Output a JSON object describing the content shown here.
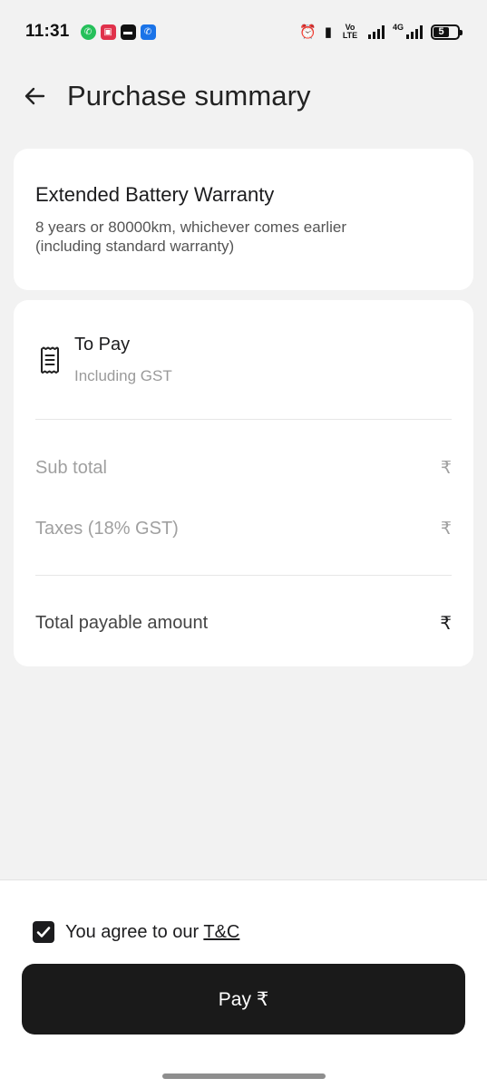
{
  "status_bar": {
    "time": "11:31",
    "battery_level": "5",
    "network_label": "4G",
    "volte_label": "Vo LTE"
  },
  "header": {
    "title": "Purchase summary"
  },
  "warranty_card": {
    "title": "Extended Battery Warranty",
    "description": "8 years or 80000km, whichever comes earlier (including standard warranty)"
  },
  "pay_card": {
    "to_pay_label": "To Pay",
    "to_pay_sub": "Including GST",
    "rows": [
      {
        "label": "Sub total",
        "value": "₹"
      },
      {
        "label": "Taxes (18% GST)",
        "value": "₹"
      }
    ],
    "total": {
      "label": "Total payable amount",
      "value": "₹"
    }
  },
  "footer": {
    "agree_text": "You agree to our",
    "tc_link": "T&C",
    "pay_button": "Pay ₹",
    "checked": true
  },
  "colors": {
    "background": "#f2f2f2",
    "card": "#ffffff",
    "primary_button": "#1a1a1a",
    "muted_text": "#a0a0a0"
  }
}
